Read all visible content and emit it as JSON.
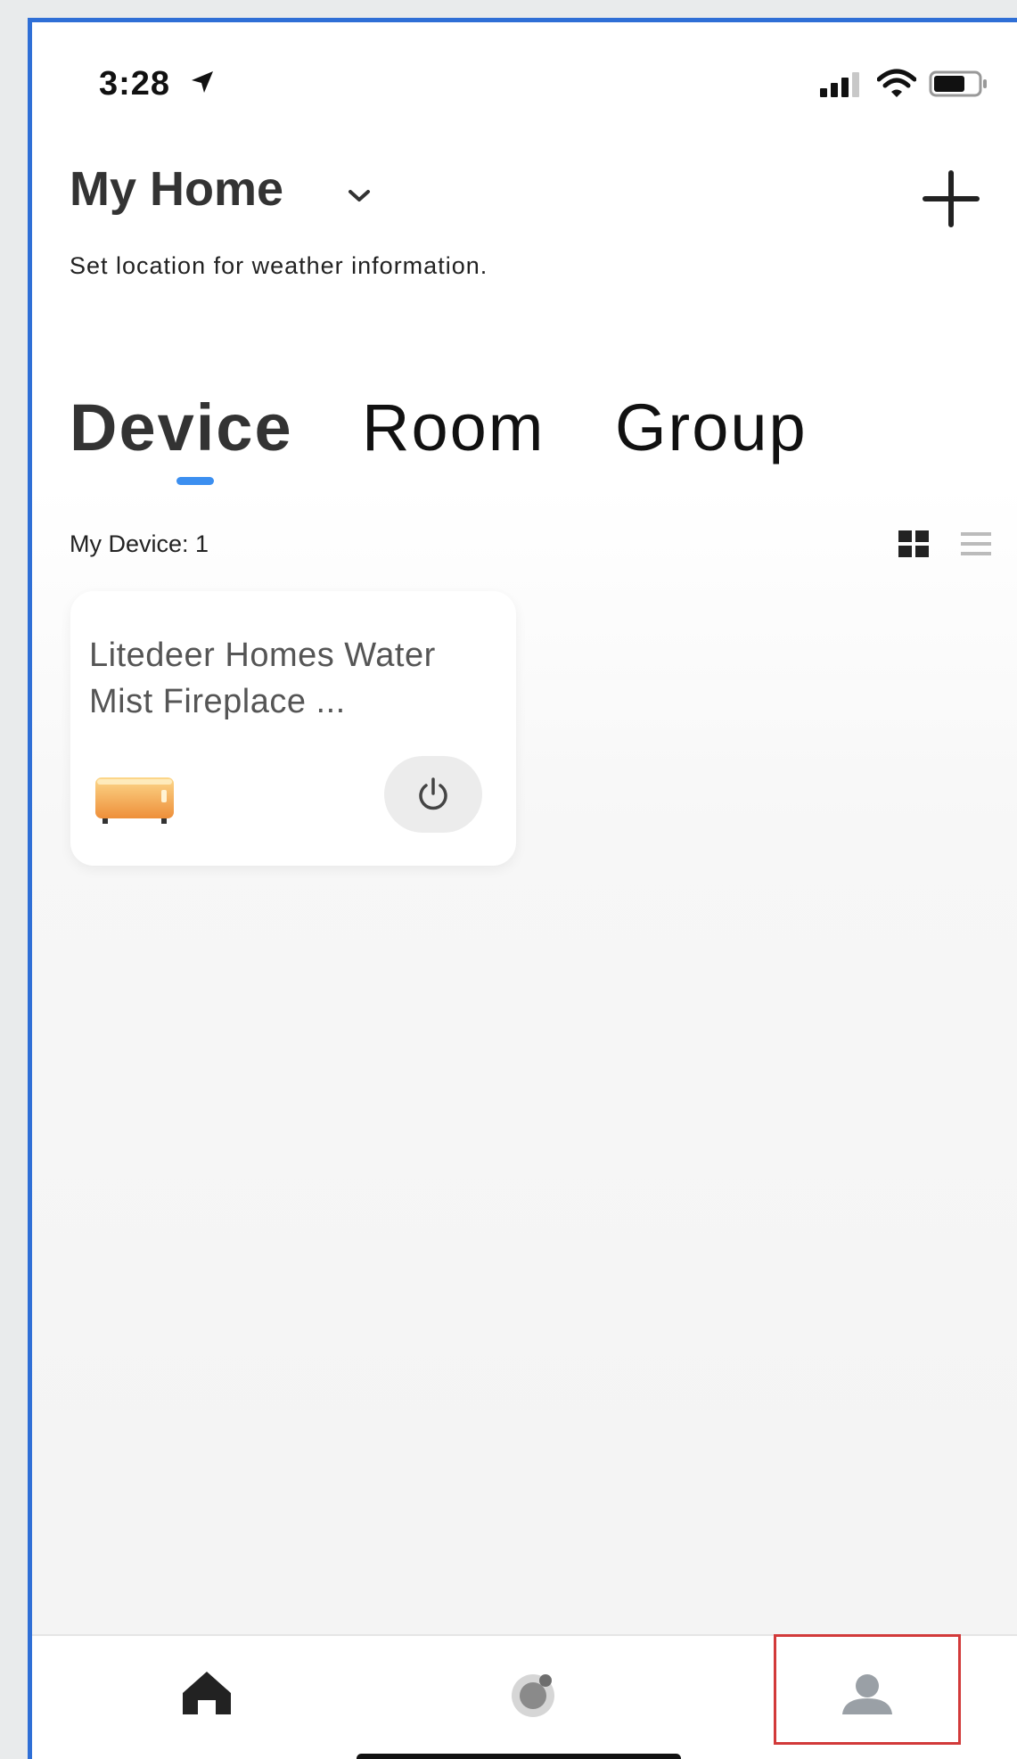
{
  "status_bar": {
    "time": "3:28"
  },
  "header": {
    "home_name": "My Home",
    "weather_prompt": "Set location for weather information."
  },
  "tabs": [
    {
      "label": "Device",
      "selected": true
    },
    {
      "label": "Room",
      "selected": false
    },
    {
      "label": "Group",
      "selected": false
    }
  ],
  "device_section": {
    "count_label": "My Device: 1",
    "view_mode": "grid"
  },
  "devices": [
    {
      "name": "Litedeer Homes Water Mist Fireplace ...",
      "icon": "fireplace-icon"
    }
  ],
  "bottom_nav": [
    {
      "icon": "home-icon"
    },
    {
      "icon": "smart-scene-icon"
    },
    {
      "icon": "profile-icon",
      "highlighted": true
    }
  ],
  "colors": {
    "accent": "#3c8ff0",
    "highlight": "#d23a3a",
    "device_icon": "#f2a24a"
  }
}
